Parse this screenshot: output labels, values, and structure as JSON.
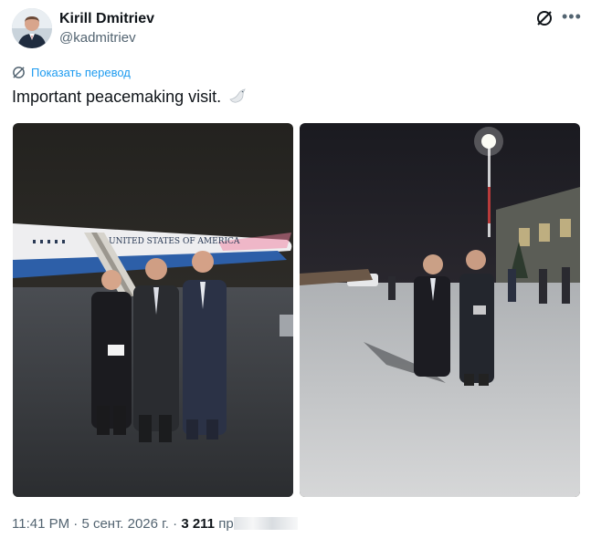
{
  "author": {
    "name": "Kirill Dmitriev",
    "handle": "@kadmitriev",
    "avatar_icon": "avatar-photo"
  },
  "header_icons": [
    "grok-icon",
    "more-icon"
  ],
  "translate": {
    "label": "Показать перевод",
    "icon": "translate-icon"
  },
  "tweet": {
    "text": "Important peacemaking visit.",
    "emoji": "dove-icon"
  },
  "photos": [
    {
      "name": "photo-plane-group",
      "plane_text": "UNITED STATES OF AMERICA"
    },
    {
      "name": "photo-tarmac-walk"
    }
  ],
  "meta": {
    "time": "11:41 PM",
    "date": "5 сент. 2026 г.",
    "views": "3 211",
    "views_label": "пр"
  },
  "colors": {
    "accent": "#1d9bf0",
    "muted": "#536471"
  }
}
